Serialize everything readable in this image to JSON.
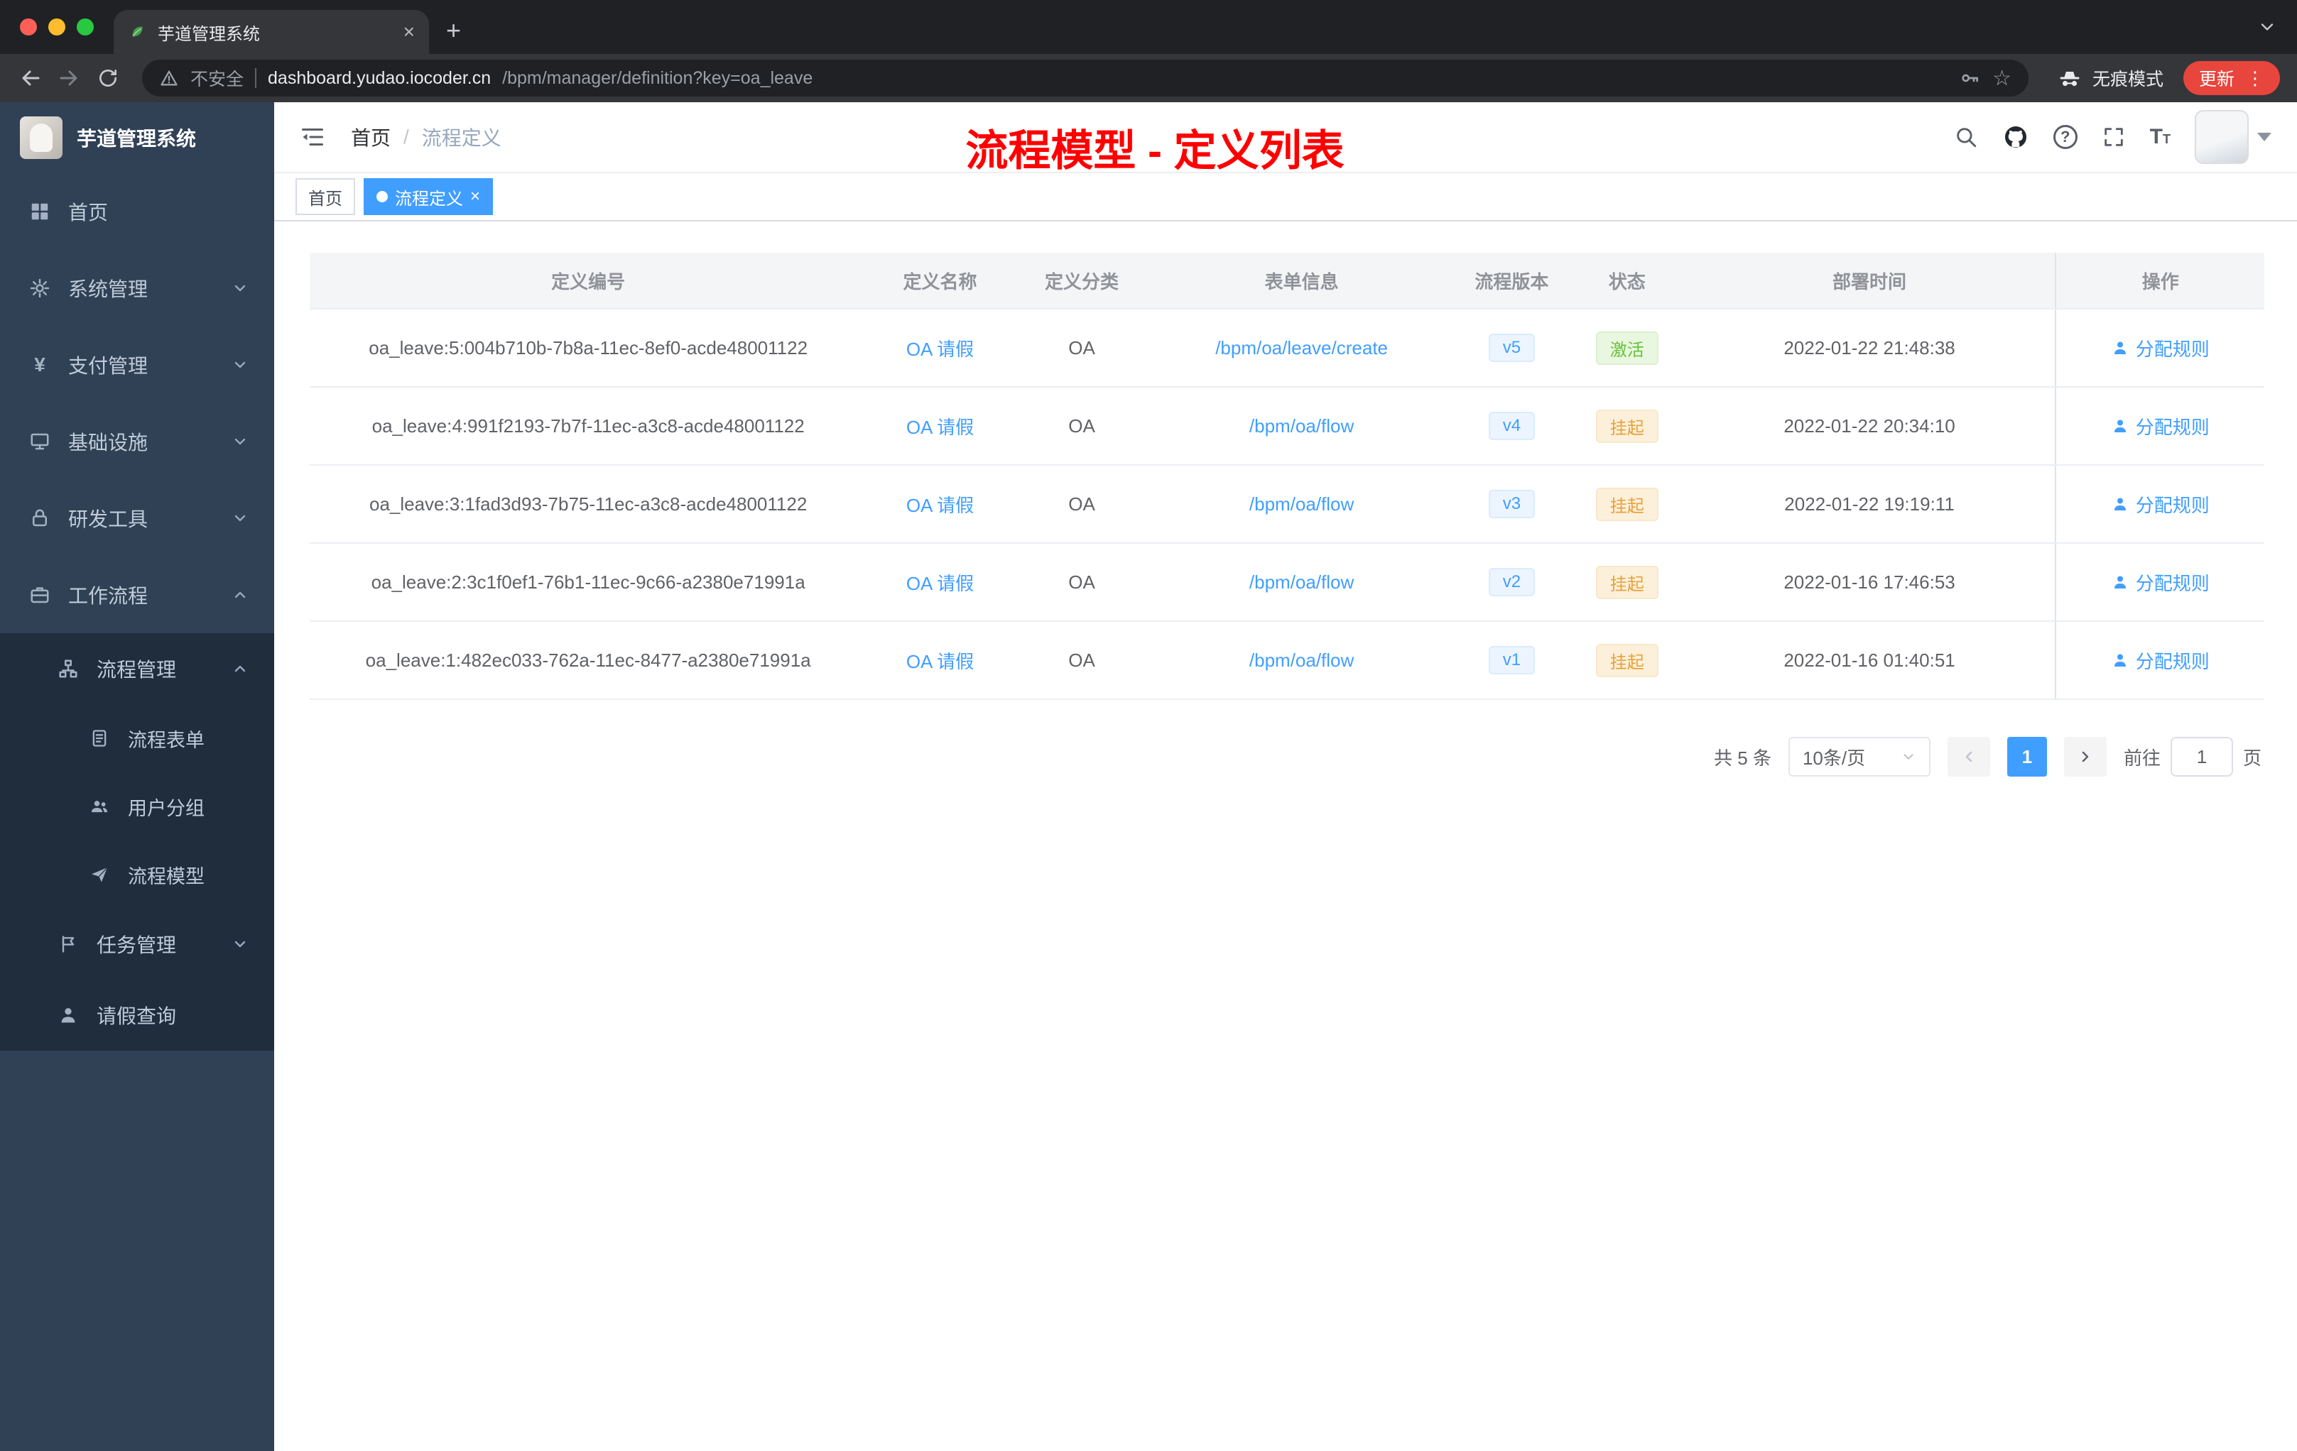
{
  "colors": {
    "accent": "#409eff",
    "success": "#67c23a",
    "warning": "#e6a23c",
    "annotation": "#ff0000",
    "sidebar_bg": "#304156",
    "sidebar_sub_bg": "#1f2d3d"
  },
  "browser": {
    "tab_title": "芋道管理系统",
    "security_label": "不安全",
    "url_domain": "dashboard.yudao.iocoder.cn",
    "url_path": "/bpm/manager/definition?key=oa_leave",
    "incognito_label": "无痕模式",
    "update_label": "更新"
  },
  "icons": {
    "yen": "¥",
    "question": "?",
    "font_large": "T",
    "font_small": "T",
    "star": "☆",
    "plus": "+",
    "kebab": "⋮",
    "close": "×"
  },
  "sidebar": {
    "logo_title": "芋道管理系统",
    "items": [
      {
        "label": "首页"
      },
      {
        "label": "系统管理"
      },
      {
        "label": "支付管理"
      },
      {
        "label": "基础设施"
      },
      {
        "label": "研发工具"
      },
      {
        "label": "工作流程"
      },
      {
        "label": "流程管理"
      },
      {
        "label": "流程表单"
      },
      {
        "label": "用户分组"
      },
      {
        "label": "流程模型"
      },
      {
        "label": "任务管理"
      },
      {
        "label": "请假查询"
      }
    ]
  },
  "topbar": {
    "breadcrumb_home": "首页",
    "breadcrumb_sep": "/",
    "breadcrumb_current": "流程定义",
    "annotation": "流程模型 - 定义列表"
  },
  "tags": {
    "home": "首页",
    "active": "流程定义"
  },
  "table": {
    "columns": {
      "id": "定义编号",
      "name": "定义名称",
      "category": "定义分类",
      "form": "表单信息",
      "version": "流程版本",
      "status": "状态",
      "deploy_time": "部署时间",
      "actions": "操作"
    },
    "rows": [
      {
        "id": "oa_leave:5:004b710b-7b8a-11ec-8ef0-acde48001122",
        "name": "OA 请假",
        "category": "OA",
        "form": "/bpm/oa/leave/create",
        "version": "v5",
        "status": "激活",
        "deploy_time": "2022-01-22 21:48:38",
        "action": "分配规则"
      },
      {
        "id": "oa_leave:4:991f2193-7b7f-11ec-a3c8-acde48001122",
        "name": "OA 请假",
        "category": "OA",
        "form": "/bpm/oa/flow",
        "version": "v4",
        "status": "挂起",
        "deploy_time": "2022-01-22 20:34:10",
        "action": "分配规则"
      },
      {
        "id": "oa_leave:3:1fad3d93-7b75-11ec-a3c8-acde48001122",
        "name": "OA 请假",
        "category": "OA",
        "form": "/bpm/oa/flow",
        "version": "v3",
        "status": "挂起",
        "deploy_time": "2022-01-22 19:19:11",
        "action": "分配规则"
      },
      {
        "id": "oa_leave:2:3c1f0ef1-76b1-11ec-9c66-a2380e71991a",
        "name": "OA 请假",
        "category": "OA",
        "form": "/bpm/oa/flow",
        "version": "v2",
        "status": "挂起",
        "deploy_time": "2022-01-16 17:46:53",
        "action": "分配规则"
      },
      {
        "id": "oa_leave:1:482ec033-762a-11ec-8477-a2380e71991a",
        "name": "OA 请假",
        "category": "OA",
        "form": "/bpm/oa/flow",
        "version": "v1",
        "status": "挂起",
        "deploy_time": "2022-01-16 01:40:51",
        "action": "分配规则"
      }
    ]
  },
  "pagination": {
    "total": "共 5 条",
    "page_size": "10条/页",
    "page": "1",
    "goto": "前往",
    "unit": "页"
  }
}
